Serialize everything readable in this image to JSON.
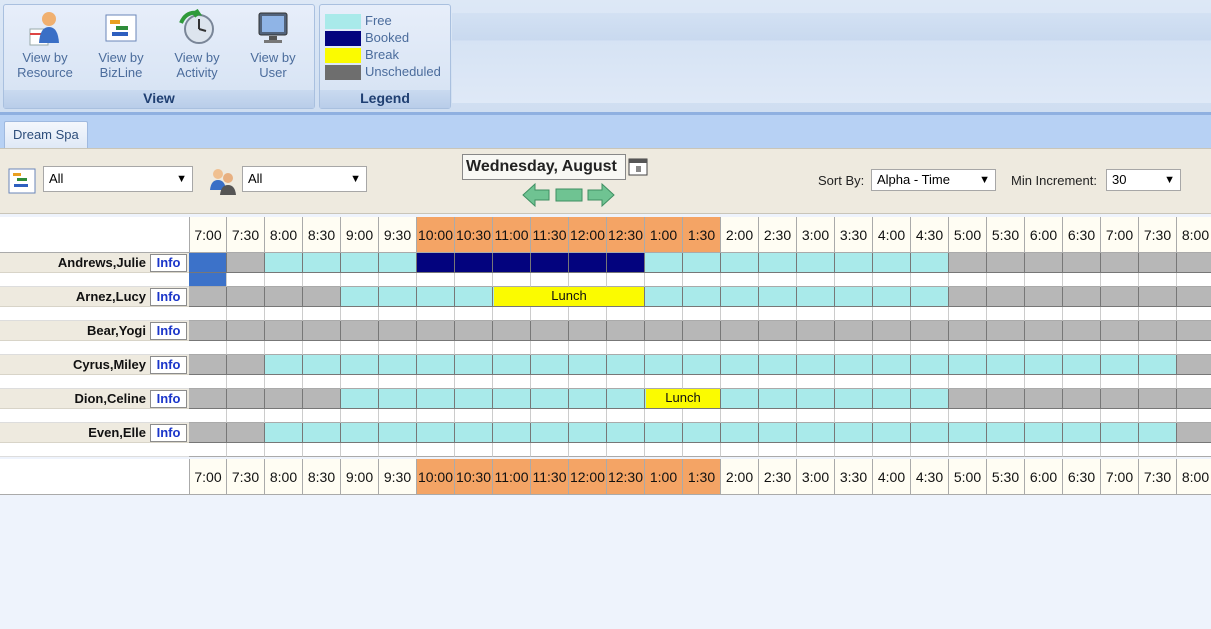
{
  "ribbon": {
    "view_group_title": "View",
    "legend_group_title": "Legend",
    "view_buttons": [
      {
        "line1": "View by",
        "line2": "Resource",
        "icon": "resource-icon"
      },
      {
        "line1": "View by",
        "line2": "BizLine",
        "icon": "bizline-icon"
      },
      {
        "line1": "View by",
        "line2": "Activity",
        "icon": "activity-clock-icon"
      },
      {
        "line1": "View by",
        "line2": "User",
        "icon": "user-monitor-icon"
      }
    ],
    "legend": [
      {
        "label": "Free",
        "color": "#a9eaea"
      },
      {
        "label": "Booked",
        "color": "#03037e"
      },
      {
        "label": "Break",
        "color": "#fbfb00"
      },
      {
        "label": "Unscheduled",
        "color": "#6e6e6e"
      }
    ]
  },
  "tabs": [
    {
      "label": "Dream Spa"
    }
  ],
  "toolbar": {
    "bizline_filter": "All",
    "user_filter": "All",
    "date": "Wednesday, August",
    "sort_by_label": "Sort By:",
    "sort_by_value": "Alpha - Time",
    "min_increment_label": "Min Increment:",
    "min_increment_value": "30"
  },
  "times": [
    "7:00",
    "7:30",
    "8:00",
    "8:30",
    "9:00",
    "9:30",
    "10:00",
    "10:30",
    "11:00",
    "11:30",
    "12:00",
    "12:30",
    "1:00",
    "1:30",
    "2:00",
    "2:30",
    "3:00",
    "3:30",
    "4:00",
    "4:30",
    "5:00",
    "5:30",
    "6:00",
    "6:30",
    "7:00",
    "7:30",
    "8:00"
  ],
  "peak_hours": [
    "10:00",
    "10:30",
    "11:00",
    "11:30",
    "12:00",
    "12:30",
    "1:00",
    "1:30"
  ],
  "info_label": "Info",
  "colors": {
    "free": "#a9eaea",
    "booked": "#03037e",
    "break": "#fbfb00",
    "unscheduled": "#b7b7b7",
    "selected": "#3c72c9",
    "peak": "#f4a465"
  },
  "resources": [
    {
      "name": "Andrews,Julie",
      "slots": [
        "selected",
        "unscheduled",
        "free",
        "free",
        "free",
        "free",
        "booked",
        "booked",
        "booked",
        "booked",
        "booked",
        "booked",
        "free",
        "free",
        "free",
        "free",
        "free",
        "free",
        "free",
        "free",
        "unscheduled",
        "unscheduled",
        "unscheduled",
        "unscheduled",
        "unscheduled",
        "unscheduled",
        "unscheduled"
      ],
      "blocks": []
    },
    {
      "name": "Arnez,Lucy",
      "slots": [
        "unscheduled",
        "unscheduled",
        "unscheduled",
        "unscheduled",
        "free",
        "free",
        "free",
        "free",
        "free",
        "free",
        "free",
        "free",
        "free",
        "free",
        "free",
        "free",
        "free",
        "free",
        "free",
        "free",
        "unscheduled",
        "unscheduled",
        "unscheduled",
        "unscheduled",
        "unscheduled",
        "unscheduled",
        "unscheduled"
      ],
      "blocks": [
        {
          "label": "Lunch",
          "start": 8,
          "span": 4
        }
      ]
    },
    {
      "name": "Bear,Yogi",
      "slots": [
        "unscheduled",
        "unscheduled",
        "unscheduled",
        "unscheduled",
        "unscheduled",
        "unscheduled",
        "unscheduled",
        "unscheduled",
        "unscheduled",
        "unscheduled",
        "unscheduled",
        "unscheduled",
        "unscheduled",
        "unscheduled",
        "unscheduled",
        "unscheduled",
        "unscheduled",
        "unscheduled",
        "unscheduled",
        "unscheduled",
        "unscheduled",
        "unscheduled",
        "unscheduled",
        "unscheduled",
        "unscheduled",
        "unscheduled",
        "unscheduled"
      ],
      "blocks": []
    },
    {
      "name": "Cyrus,Miley",
      "slots": [
        "unscheduled",
        "unscheduled",
        "free",
        "free",
        "free",
        "free",
        "free",
        "free",
        "free",
        "free",
        "free",
        "free",
        "free",
        "free",
        "free",
        "free",
        "free",
        "free",
        "free",
        "free",
        "free",
        "free",
        "free",
        "free",
        "free",
        "free",
        "unscheduled"
      ],
      "blocks": []
    },
    {
      "name": "Dion,Celine",
      "slots": [
        "unscheduled",
        "unscheduled",
        "unscheduled",
        "unscheduled",
        "free",
        "free",
        "free",
        "free",
        "free",
        "free",
        "free",
        "free",
        "free",
        "free",
        "free",
        "free",
        "free",
        "free",
        "free",
        "free",
        "unscheduled",
        "unscheduled",
        "unscheduled",
        "unscheduled",
        "unscheduled",
        "unscheduled",
        "unscheduled"
      ],
      "blocks": [
        {
          "label": "Lunch",
          "start": 12,
          "span": 2
        }
      ]
    },
    {
      "name": "Even,Elle",
      "slots": [
        "unscheduled",
        "unscheduled",
        "free",
        "free",
        "free",
        "free",
        "free",
        "free",
        "free",
        "free",
        "free",
        "free",
        "free",
        "free",
        "free",
        "free",
        "free",
        "free",
        "free",
        "free",
        "free",
        "free",
        "free",
        "free",
        "free",
        "free",
        "unscheduled"
      ],
      "blocks": []
    }
  ]
}
